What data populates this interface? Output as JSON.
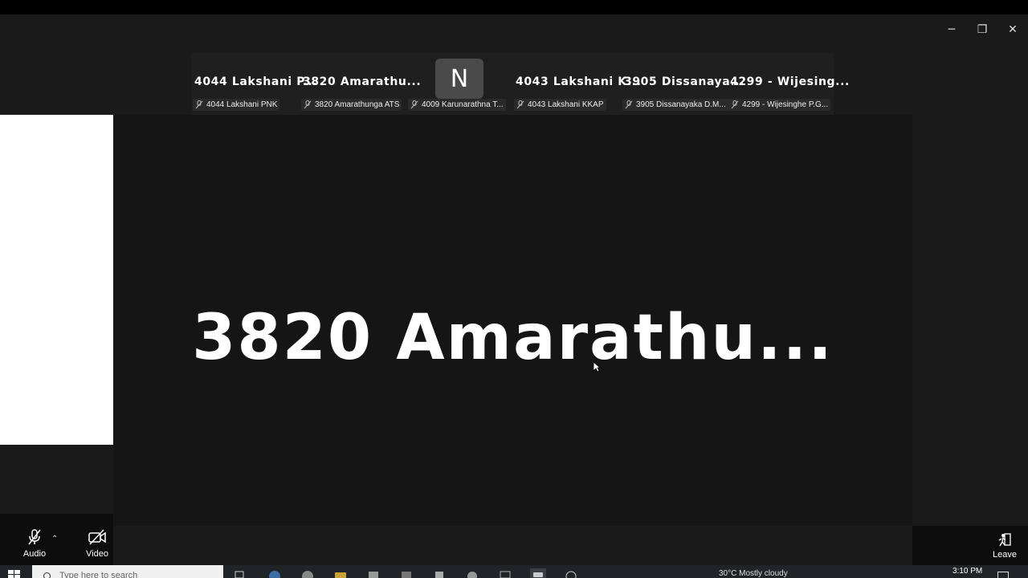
{
  "window": {
    "controls": {
      "minimize": "─",
      "restore": "❐",
      "close": "✕"
    }
  },
  "participants": [
    {
      "display_name": "4044  Lakshani  P...",
      "label": "4044 Lakshani PNK"
    },
    {
      "display_name": "3820  Amarathu...",
      "label": "3820 Amarathunga ATS"
    },
    {
      "display_name": "",
      "avatar_letter": "N",
      "label": "4009 Karunarathna T..."
    },
    {
      "display_name": "4043  Lakshani  K...",
      "label": "4043 Lakshani KKAP"
    },
    {
      "display_name": "3905  Dissanaya...",
      "label": "3905 Dissanayaka D.M..."
    },
    {
      "display_name": "4299  -  Wijesing...",
      "label": "4299 - Wijesinghe P.G..."
    }
  ],
  "active_speaker": {
    "display_name": "3820  Amarathu..."
  },
  "controls": {
    "audio_label": "Audio",
    "video_label": "Video",
    "leave_label": "Leave"
  },
  "taskbar": {
    "search_placeholder": "Type here to search",
    "weather": "30°C  Mostly cloudy",
    "time": "3:10 PM"
  },
  "colors": {
    "background": "#151515",
    "tile_label_bg": "#2a2a2a",
    "accent": "#ffffff"
  }
}
